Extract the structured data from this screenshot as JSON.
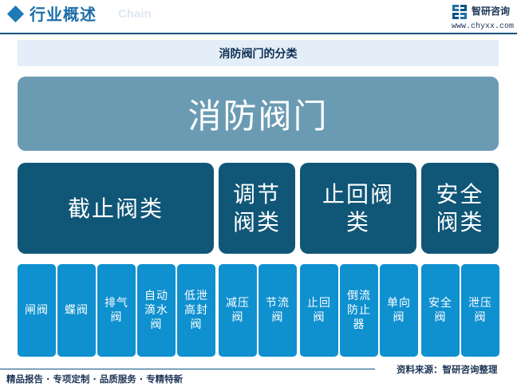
{
  "header": {
    "title": "行业概述",
    "subtitle": "Chain",
    "brand_name": "智研咨询",
    "brand_url": "www.chyxx.com"
  },
  "diagram": {
    "banner_title": "消防阀门的分类",
    "root": "消防阀门",
    "categories": [
      {
        "label": "截止阀类",
        "items": [
          "闸阀",
          "蝶阀",
          "排气阀",
          "自动滴水阀",
          "低泄高封阀"
        ]
      },
      {
        "label": "调节阀类",
        "items": [
          "减压阀",
          "节流阀"
        ]
      },
      {
        "label": "止回阀类",
        "items": [
          "止回阀",
          "倒流防止器",
          "单向阀"
        ]
      },
      {
        "label": "安全阀类",
        "items": [
          "安全阀",
          "泄压阀"
        ]
      }
    ]
  },
  "footer": {
    "slogan": "精品报告 · 专项定制 · 品质服务 · 专精特新",
    "source": "资料来源：智研咨询整理"
  },
  "colors": {
    "root": "#6b9bb3",
    "category": "#105677",
    "item": "#0f90cf",
    "banner": "#e4eef8",
    "accent": "#1f7ab8"
  }
}
